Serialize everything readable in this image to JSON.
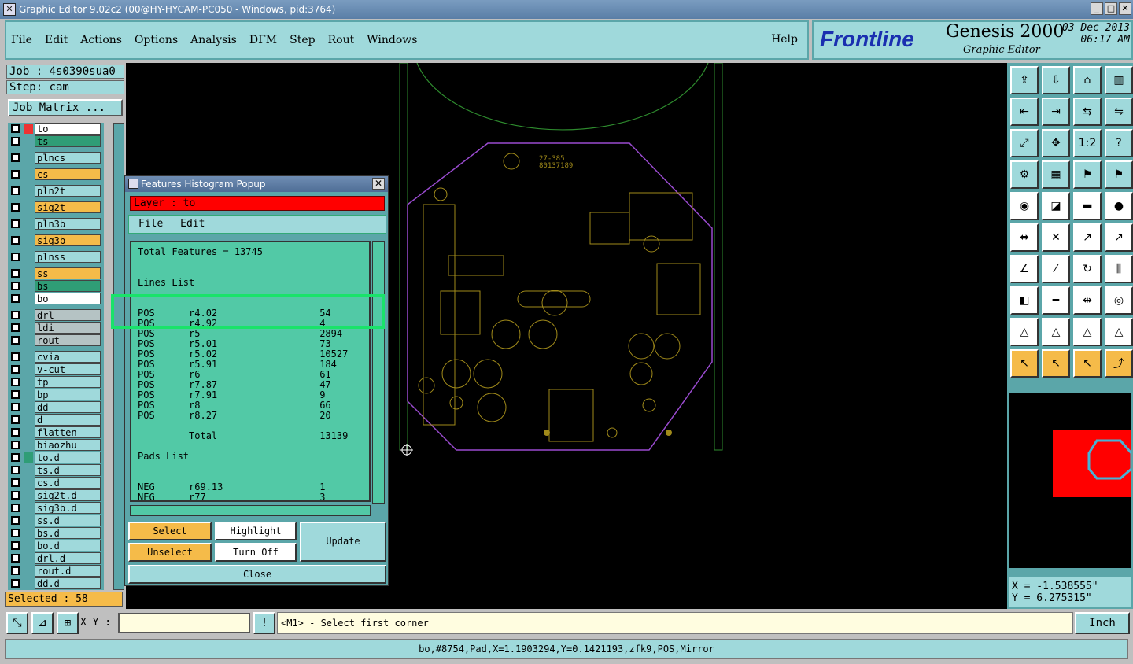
{
  "window": {
    "title": "Graphic Editor 9.02c2 (00@HY-HYCAM-PC050 - Windows, pid:3764)"
  },
  "menu": {
    "items": [
      "File",
      "Edit",
      "Actions",
      "Options",
      "Analysis",
      "DFM",
      "Step",
      "Rout",
      "Windows"
    ],
    "help": "Help"
  },
  "brand": {
    "logo": "Frontline",
    "product": "Genesis 2000",
    "subtitle": "Graphic Editor",
    "date": "03 Dec 2013",
    "time": "06:17 AM"
  },
  "job": {
    "job_label": "Job : 4s0390sua0",
    "step_label": "Step: cam",
    "matrix_button": "Job Matrix ..."
  },
  "layers": [
    {
      "name": "to",
      "color": "white"
    },
    {
      "name": "ts",
      "color": "green"
    },
    {
      "name": "plncs",
      "color": "cyan"
    },
    {
      "name": "cs",
      "color": "orange"
    },
    {
      "name": "pln2t",
      "color": "cyan"
    },
    {
      "name": "sig2t",
      "color": "orange"
    },
    {
      "name": "pln3b",
      "color": "cyan"
    },
    {
      "name": "sig3b",
      "color": "orange"
    },
    {
      "name": "plnss",
      "color": "cyan"
    },
    {
      "name": "ss",
      "color": "orange"
    },
    {
      "name": "bs",
      "color": "green"
    },
    {
      "name": "bo",
      "color": "white"
    },
    {
      "name": "drl",
      "color": "grey"
    },
    {
      "name": "ldi",
      "color": "grey"
    },
    {
      "name": "rout",
      "color": "grey"
    },
    {
      "name": "cvia",
      "color": "cyan"
    },
    {
      "name": "v-cut",
      "color": "cyan"
    },
    {
      "name": "tp",
      "color": "cyan"
    },
    {
      "name": "bp",
      "color": "cyan"
    },
    {
      "name": "dd",
      "color": "cyan"
    },
    {
      "name": "d",
      "color": "cyan"
    },
    {
      "name": "flatten",
      "color": "cyan"
    },
    {
      "name": "biaozhu",
      "color": "cyan"
    },
    {
      "name": "to.d",
      "color": "cyan"
    },
    {
      "name": "ts.d",
      "color": "cyan"
    },
    {
      "name": "cs.d",
      "color": "cyan"
    },
    {
      "name": "sig2t.d",
      "color": "cyan"
    },
    {
      "name": "sig3b.d",
      "color": "cyan"
    },
    {
      "name": "ss.d",
      "color": "cyan"
    },
    {
      "name": "bs.d",
      "color": "cyan"
    },
    {
      "name": "bo.d",
      "color": "cyan"
    },
    {
      "name": "drl.d",
      "color": "cyan"
    },
    {
      "name": "rout.d",
      "color": "cyan"
    },
    {
      "name": "dd.d",
      "color": "cyan"
    }
  ],
  "selected": "Selected : 58",
  "popup": {
    "title": "Features Histogram Popup",
    "layer": "Layer :  to",
    "menu": [
      "File",
      "Edit"
    ],
    "lines": [
      "Total Features = 13745",
      "",
      "",
      "Lines List",
      "----------",
      "",
      "POS      r4.02                  54",
      "POS      r4.92                  4",
      "POS      r5                     2894",
      "POS      r5.01                  73",
      "POS      r5.02                  10527",
      "POS      r5.91                  184",
      "POS      r6                     61",
      "POS      r7.87                  47",
      "POS      r7.91                  9",
      "POS      r8                     66",
      "POS      r8.27                  20",
      "-----------------------------------------",
      "         Total                  13139",
      "",
      "Pads List",
      "---------",
      "",
      "NEG      r69.13                 1",
      "NEG      r77                    3"
    ],
    "buttons": {
      "select": "Select",
      "highlight": "Highlight",
      "unselect": "Unselect",
      "turn_off": "Turn Off",
      "update": "Update",
      "close": "Close"
    }
  },
  "board": {
    "label1": "27-385",
    "label2": "80137189"
  },
  "coords": {
    "x": "X = -1.538555\"",
    "y": "Y =  6.275315\""
  },
  "bottom": {
    "xy_label": "X Y :",
    "xy_value": "",
    "prompt": "<M1> - Select first corner",
    "unit": "Inch"
  },
  "status": "bo,#8754,Pad,X=1.1903294,Y=0.1421193,zfk9,POS,Mirror"
}
